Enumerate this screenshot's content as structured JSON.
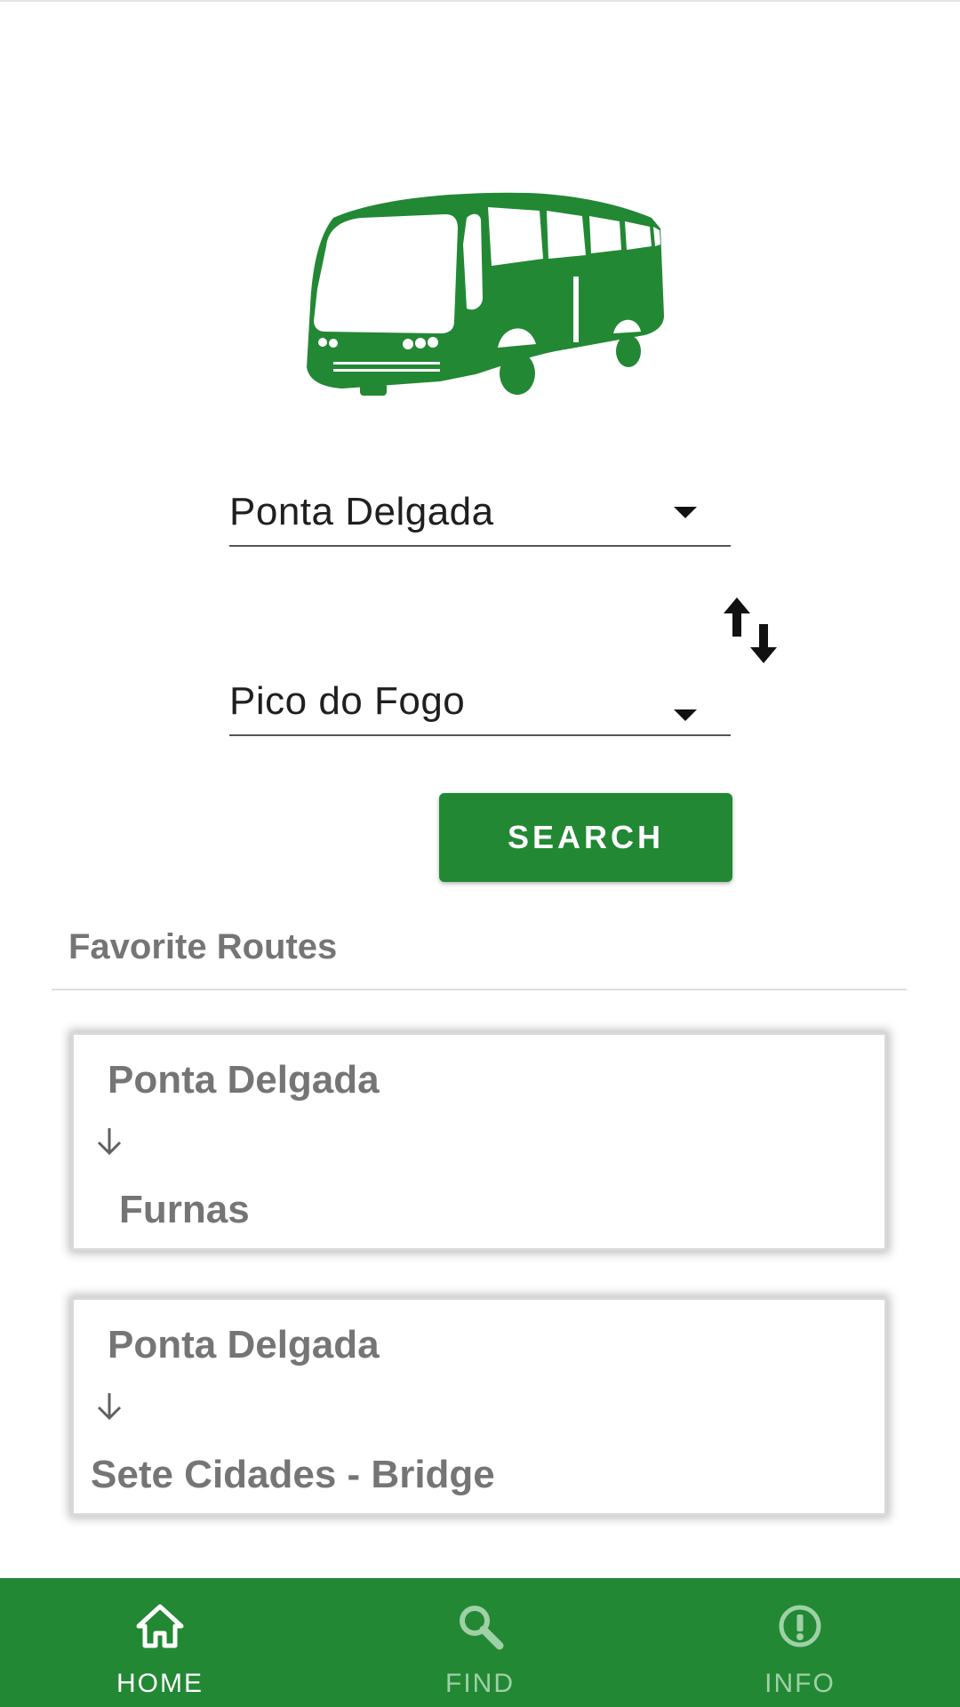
{
  "app": {
    "accent_color": "#228834",
    "logo_icon": "bus-icon"
  },
  "route_picker": {
    "from_value": "Ponta Delgada",
    "to_value": "Pico do Fogo",
    "swap_icon": "swap-vertical-icon",
    "search_label": "SEARCH"
  },
  "favorites": {
    "title": "Favorite Routes",
    "routes": [
      {
        "from": "Ponta Delgada",
        "to": "Furnas"
      },
      {
        "from": "Ponta Delgada",
        "to": "Sete Cidades - Bridge"
      }
    ]
  },
  "bottom_nav": {
    "items": [
      {
        "label": "HOME",
        "icon": "home-icon",
        "active": true
      },
      {
        "label": "FIND",
        "icon": "search-icon",
        "active": false
      },
      {
        "label": "INFO",
        "icon": "info-icon",
        "active": false
      }
    ]
  }
}
